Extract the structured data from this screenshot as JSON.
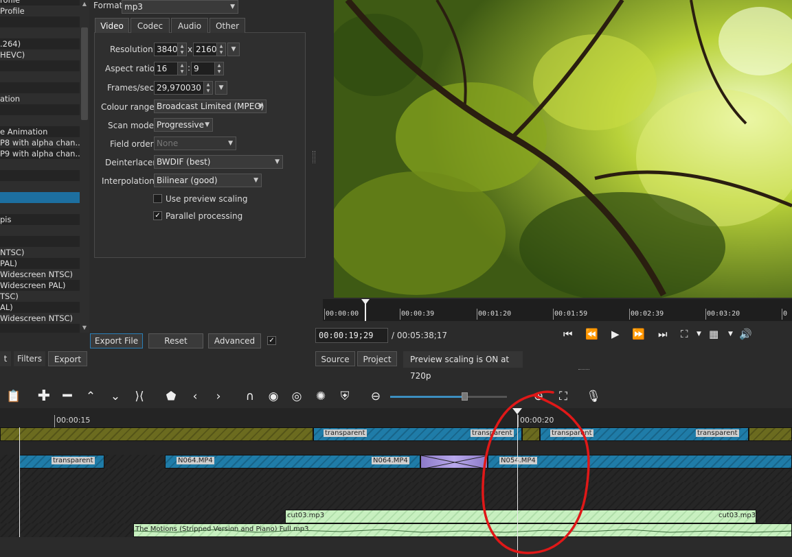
{
  "left_list": {
    "items": [
      {
        "label": "rofile"
      },
      {
        "label": "Profile"
      },
      {
        "label": ""
      },
      {
        "label": ""
      },
      {
        "label": ".264)"
      },
      {
        "label": "HEVC)"
      },
      {
        "label": ""
      },
      {
        "label": ""
      },
      {
        "label": ""
      },
      {
        "label": "ation"
      },
      {
        "label": ""
      },
      {
        "label": ""
      },
      {
        "label": "e Animation"
      },
      {
        "label": "P8 with alpha chan..."
      },
      {
        "label": "P9 with alpha chan..."
      },
      {
        "label": ""
      },
      {
        "label": ""
      },
      {
        "label": ""
      },
      {
        "label": ""
      },
      {
        "label": ""
      },
      {
        "label": "pis"
      },
      {
        "label": ""
      },
      {
        "label": ""
      },
      {
        "label": "NTSC)"
      },
      {
        "label": "PAL)"
      },
      {
        "label": "Widescreen NTSC)"
      },
      {
        "label": "Widescreen PAL)"
      },
      {
        "label": "TSC)"
      },
      {
        "label": "AL)"
      },
      {
        "label": "Widescreen NTSC)"
      }
    ],
    "selected_index": 18
  },
  "export": {
    "format_label": "Format",
    "format_value": "mp3",
    "tabs": [
      "Video",
      "Codec",
      "Audio",
      "Other"
    ],
    "active_tab": "Video",
    "resolution_label": "Resolution",
    "resolution_w": "3840",
    "resolution_x": "x",
    "resolution_h": "2160",
    "aspect_label": "Aspect ratio",
    "aspect_w": "16",
    "aspect_sep": ":",
    "aspect_h": "9",
    "fps_label": "Frames/sec",
    "fps_value": "29,970030",
    "colour_label": "Colour range",
    "colour_value": "Broadcast Limited (MPEG)",
    "scan_label": "Scan mode",
    "scan_value": "Progressive",
    "field_label": "Field order",
    "field_value": "None",
    "deint_label": "Deinterlacer",
    "deint_value": "BWDIF (best)",
    "interp_label": "Interpolation",
    "interp_value": "Bilinear (good)",
    "preview_scaling_label": "Use preview scaling",
    "preview_scaling_checked": false,
    "parallel_label": "Parallel processing",
    "parallel_checked": true,
    "export_file_label": "Export File",
    "reset_label": "Reset",
    "advanced_label": "Advanced",
    "advanced_checked": true
  },
  "bottom_tabs": [
    "t",
    "Filters",
    "Export"
  ],
  "player": {
    "ruler_labels": [
      "00:00:00",
      "00:00:39",
      "00:01:20",
      "00:01:59",
      "00:02:39",
      "00:03:20",
      "0"
    ],
    "current_time": "00:00:19;29",
    "duration": "/ 00:05:38;17",
    "source_tab": "Source",
    "project_tab": "Project",
    "status": "Preview scaling is ON at 720p"
  },
  "timeline": {
    "ruler_labels": [
      "00:00:15",
      "00:00:20"
    ],
    "clips": {
      "transparent_1": "transparent",
      "transparent_2": "transparent",
      "transparent_3": "transparent",
      "transparent_4": "transparent",
      "transparent_5": "transparent",
      "n064_a": "N064.MP4",
      "n064_b": "N064.MP4",
      "n054": "N054.MP4",
      "cut03_a": "cut03.mp3",
      "cut03_b": "cut03.mp3",
      "motions": "The Motions (Stripped Version and Piano) Full.mp3"
    }
  },
  "colors": {
    "accent_blue": "#1f7ca8",
    "olive_track": "#6b6b1f",
    "audio_green": "#c8f0c0",
    "annotation_red": "#e01818"
  }
}
